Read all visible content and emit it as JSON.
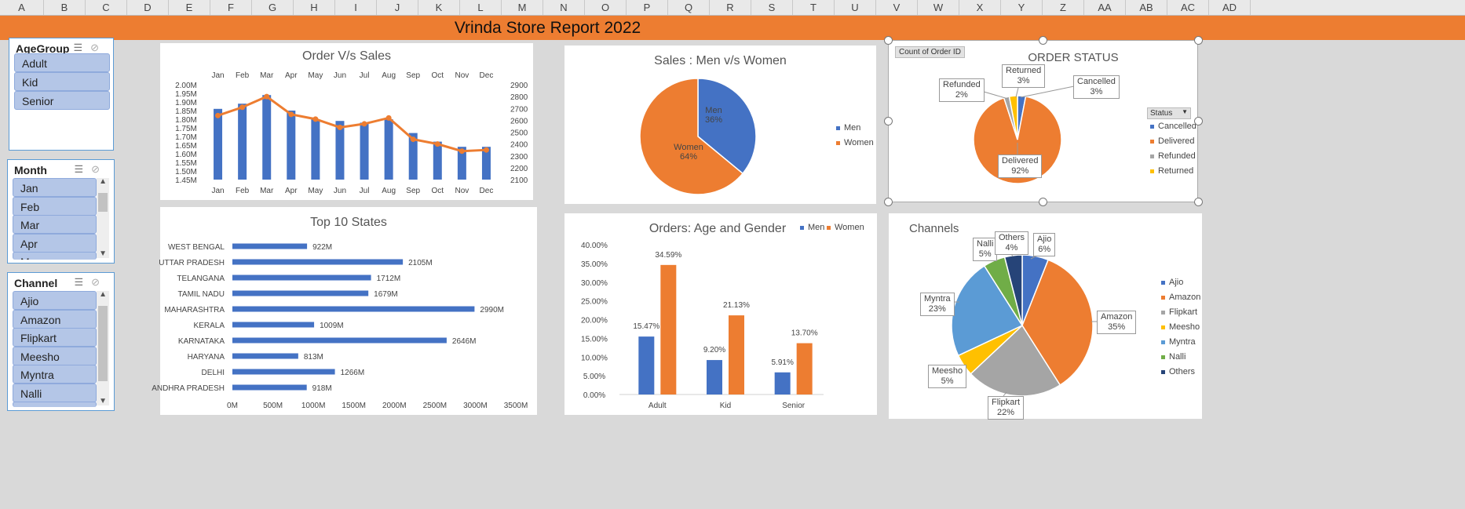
{
  "columns": [
    "A",
    "B",
    "C",
    "D",
    "E",
    "F",
    "G",
    "H",
    "I",
    "J",
    "K",
    "L",
    "M",
    "N",
    "O",
    "P",
    "Q",
    "R",
    "S",
    "T",
    "U",
    "V",
    "W",
    "X",
    "Y",
    "Z",
    "AA",
    "AB",
    "AC",
    "AD"
  ],
  "report_title": "Vrinda Store Report 2022",
  "icons": {
    "multi_select": "multi-select-icon",
    "clear_filter": "clear-filter-icon",
    "scroll_up": "scroll-up-icon",
    "scroll_down": "scroll-down-icon"
  },
  "colors": {
    "header_orange": "#ed7d31",
    "blue": "#4472c4",
    "orange": "#ed7d31",
    "gray": "#a5a5a5",
    "yellow": "#ffc000",
    "light_blue": "#5b9bd5",
    "green": "#70ad47",
    "navy": "#264478",
    "slicer_item": "#b4c6e7"
  },
  "slicers": {
    "age": {
      "title": "AgeGroup",
      "items": [
        "Adult",
        "Kid",
        "Senior"
      ]
    },
    "month": {
      "title": "Month",
      "items": [
        "Jan",
        "Feb",
        "Mar",
        "Apr",
        "M"
      ]
    },
    "channel": {
      "title": "Channel",
      "items": [
        "Ajio",
        "Amazon",
        "Flipkart",
        "Meesho",
        "Myntra",
        "Nalli",
        "L"
      ]
    }
  },
  "chart_data": [
    {
      "id": "order_sales",
      "type": "bar",
      "title": "Order V/s Sales",
      "categories": [
        "Jan",
        "Feb",
        "Mar",
        "Apr",
        "May",
        "Jun",
        "Jul",
        "Aug",
        "Sep",
        "Oct",
        "Nov",
        "Dec"
      ],
      "series": [
        {
          "type": "bar",
          "axis": "left",
          "color": "#4472c4",
          "values": [
            1.86,
            1.89,
            1.94,
            1.85,
            1.8,
            1.79,
            1.78,
            1.8,
            1.72,
            1.67,
            1.64,
            1.64
          ]
        },
        {
          "type": "line",
          "axis": "right",
          "color": "#ed7d31",
          "values": [
            2640,
            2710,
            2800,
            2650,
            2610,
            2540,
            2570,
            2620,
            2440,
            2400,
            2340,
            2350
          ]
        }
      ],
      "left_axis": {
        "min": 1.45,
        "max": 2.0,
        "step": 0.05,
        "ticks": [
          "1.45M",
          "1.50M",
          "1.55M",
          "1.60M",
          "1.65M",
          "1.70M",
          "1.75M",
          "1.80M",
          "1.85M",
          "1.90M",
          "1.95M",
          "2.00M"
        ]
      },
      "right_axis": {
        "min": 2100,
        "max": 2900,
        "step": 100,
        "ticks": [
          "2100",
          "2200",
          "2300",
          "2400",
          "2500",
          "2600",
          "2700",
          "2800",
          "2900"
        ]
      }
    },
    {
      "id": "gender_pie",
      "type": "pie",
      "title": "Sales : Men v/s Women",
      "slices": [
        {
          "label": "Men",
          "value": 36,
          "text": "36%",
          "color": "#4472c4"
        },
        {
          "label": "Women",
          "value": 64,
          "text": "64%",
          "color": "#ed7d31"
        }
      ]
    },
    {
      "id": "order_status",
      "type": "pie",
      "title": "ORDER STATUS",
      "field_button": "Count of Order ID",
      "filter_button": "Status",
      "slices": [
        {
          "label": "Cancelled",
          "value": 3,
          "text": "3%",
          "color": "#4472c4"
        },
        {
          "label": "Delivered",
          "value": 92,
          "text": "92%",
          "color": "#ed7d31"
        },
        {
          "label": "Refunded",
          "value": 2,
          "text": "2%",
          "color": "#a5a5a5"
        },
        {
          "label": "Returned",
          "value": 3,
          "text": "3%",
          "color": "#ffc000"
        }
      ]
    },
    {
      "id": "top_states",
      "type": "bar",
      "orientation": "horizontal",
      "title": "Top 10 States",
      "categories": [
        "WEST BENGAL",
        "UTTAR PRADESH",
        "TELANGANA",
        "TAMIL NADU",
        "MAHARASHTRA",
        "KERALA",
        "KARNATAKA",
        "HARYANA",
        "DELHI",
        "ANDHRA PRADESH"
      ],
      "values": [
        922,
        2105,
        1712,
        1679,
        2990,
        1009,
        2646,
        813,
        1266,
        918
      ],
      "value_labels": [
        "922M",
        "2105M",
        "1712M",
        "1679M",
        "2990M",
        "1009M",
        "2646M",
        "813M",
        "1266M",
        "918M"
      ],
      "xlim": [
        0,
        3500
      ],
      "xticks": [
        "0M",
        "500M",
        "1000M",
        "1500M",
        "2000M",
        "2500M",
        "3000M",
        "3500M"
      ],
      "color": "#4472c4"
    },
    {
      "id": "age_gender",
      "type": "bar",
      "title": "Orders: Age and Gender",
      "categories": [
        "Adult",
        "Kid",
        "Senior"
      ],
      "series": [
        {
          "name": "Men",
          "values": [
            15.47,
            9.2,
            5.91
          ],
          "labels": [
            "15.47%",
            "9.20%",
            "5.91%"
          ],
          "color": "#4472c4"
        },
        {
          "name": "Women",
          "values": [
            34.59,
            21.13,
            13.7
          ],
          "labels": [
            "34.59%",
            "21.13%",
            "13.70%"
          ],
          "color": "#ed7d31"
        }
      ],
      "ylim": [
        0,
        40
      ],
      "yticks": [
        "0.00%",
        "5.00%",
        "10.00%",
        "15.00%",
        "20.00%",
        "25.00%",
        "30.00%",
        "35.00%",
        "40.00%"
      ]
    },
    {
      "id": "channels",
      "type": "pie",
      "title": "Channels",
      "slices": [
        {
          "label": "Ajio",
          "value": 6,
          "text": "6%",
          "color": "#4472c4"
        },
        {
          "label": "Amazon",
          "value": 35,
          "text": "35%",
          "color": "#ed7d31"
        },
        {
          "label": "Flipkart",
          "value": 22,
          "text": "22%",
          "color": "#a5a5a5"
        },
        {
          "label": "Meesho",
          "value": 5,
          "text": "5%",
          "color": "#ffc000"
        },
        {
          "label": "Myntra",
          "value": 23,
          "text": "23%",
          "color": "#5b9bd5"
        },
        {
          "label": "Nalli",
          "value": 5,
          "text": "5%",
          "color": "#70ad47"
        },
        {
          "label": "Others",
          "value": 4,
          "text": "4%",
          "color": "#264478"
        }
      ]
    }
  ]
}
